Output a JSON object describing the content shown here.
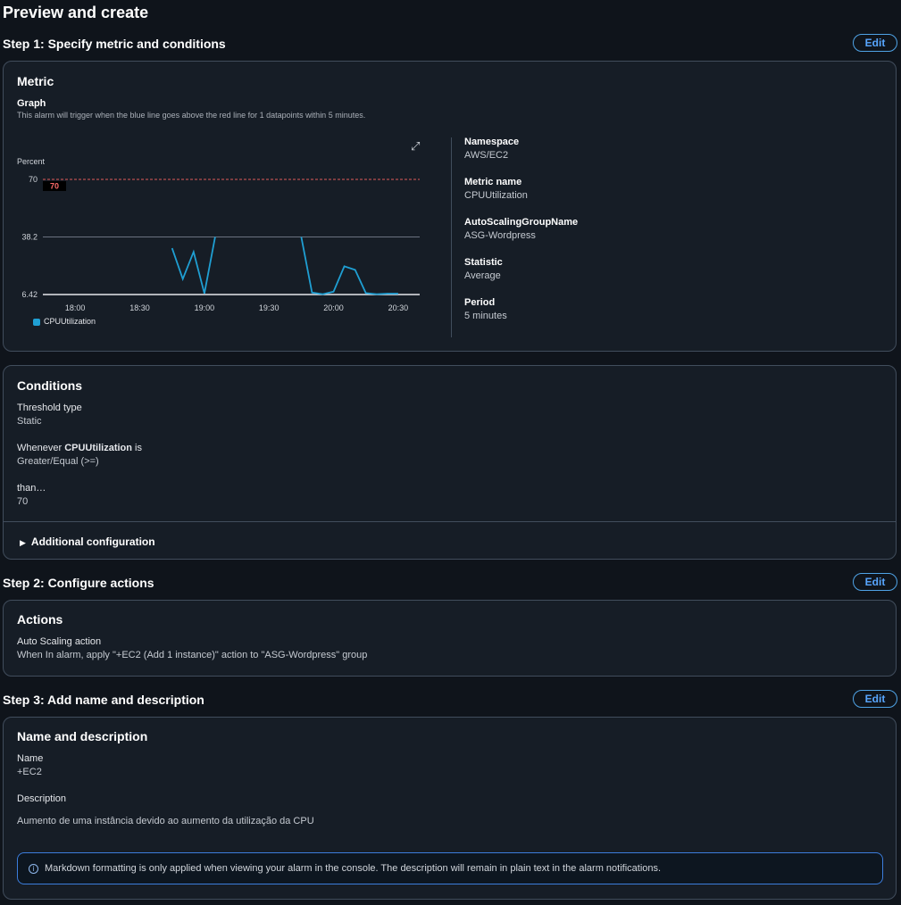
{
  "page": {
    "title": "Preview and create"
  },
  "step1": {
    "title": "Step 1: Specify metric and conditions",
    "edit": "Edit",
    "metric": {
      "title": "Metric",
      "graph_label": "Graph",
      "graph_desc": "This alarm will trigger when the blue line goes above the red line for 1 datapoints within 5 minutes.",
      "expand_icon": "expand-icon",
      "details": [
        {
          "label": "Namespace",
          "value": "AWS/EC2"
        },
        {
          "label": "Metric name",
          "value": "CPUUtilization"
        },
        {
          "label": "AutoScalingGroupName",
          "value": "ASG-Wordpress"
        },
        {
          "label": "Statistic",
          "value": "Average"
        },
        {
          "label": "Period",
          "value": "5 minutes"
        }
      ]
    },
    "conditions": {
      "title": "Conditions",
      "threshold_type_label": "Threshold type",
      "threshold_type_value": "Static",
      "whenever_prefix": "Whenever ",
      "whenever_metric": "CPUUtilization",
      "whenever_suffix": " is",
      "operator_value": "Greater/Equal (>=)",
      "than_label": "than…",
      "than_value": "70",
      "additional_config": "Additional configuration"
    }
  },
  "step2": {
    "title": "Step 2: Configure actions",
    "edit": "Edit",
    "actions": {
      "title": "Actions",
      "label": "Auto Scaling action",
      "value": "When In alarm, apply \"+EC2 (Add 1 instance)\" action to \"ASG-Wordpress\" group"
    }
  },
  "step3": {
    "title": "Step 3: Add name and description",
    "edit": "Edit",
    "panel": {
      "title": "Name and description",
      "name_label": "Name",
      "name_value": "+EC2",
      "desc_label": "Description",
      "desc_value": "Aumento de uma instância devido ao aumento da utilização da CPU",
      "info": "Markdown formatting is only applied when viewing your alarm in the console. The description will remain in plain text in the alarm notifications."
    }
  },
  "colors": {
    "series": "#1f9fd3",
    "threshold": "#e05a5a",
    "accent": "#58a6ff"
  },
  "chart_data": {
    "type": "line",
    "ylabel": "Percent",
    "yticks": [
      6.42,
      38.2,
      70
    ],
    "ylim": [
      6.42,
      70
    ],
    "xticks": [
      "18:00",
      "18:30",
      "19:00",
      "19:30",
      "20:00",
      "20:30"
    ],
    "threshold": {
      "value": 70,
      "label": "70"
    },
    "legend": "CPUUtilization",
    "series": [
      {
        "name": "CPUUtilization",
        "segments": [
          [
            [
              "18:45",
              32
            ],
            [
              "18:50",
              15
            ],
            [
              "18:55",
              30
            ],
            [
              "19:00",
              7
            ],
            [
              "19:05",
              38.2
            ]
          ],
          [
            [
              "19:45",
              38.2
            ],
            [
              "19:50",
              7.5
            ],
            [
              "19:55",
              6.6
            ],
            [
              "20:00",
              8
            ],
            [
              "20:05",
              22
            ],
            [
              "20:10",
              20
            ],
            [
              "20:15",
              7.2
            ],
            [
              "20:20",
              6.6
            ],
            [
              "20:25",
              6.9
            ],
            [
              "20:30",
              6.9
            ]
          ]
        ]
      }
    ]
  }
}
